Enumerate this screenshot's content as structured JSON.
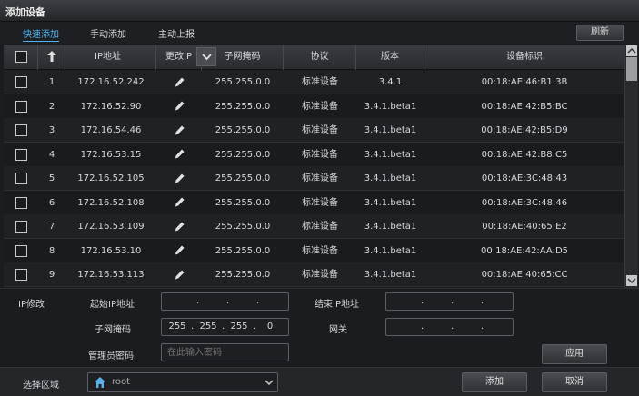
{
  "window": {
    "title": "添加设备"
  },
  "tabs": [
    {
      "label": "快速添加",
      "active": true
    },
    {
      "label": "手动添加",
      "active": false
    },
    {
      "label": "主动上报",
      "active": false
    }
  ],
  "toolbar": {
    "refresh_label": "刷新"
  },
  "table": {
    "columns": [
      "IP地址",
      "更改IP",
      "子网掩码",
      "协议",
      "版本",
      "设备标识"
    ],
    "rows": [
      {
        "index": "1",
        "ip": "172.16.52.242",
        "mask": "255.255.0.0",
        "protocol": "标准设备",
        "version": "3.4.1",
        "id": "00:18:AE:46:B1:3B"
      },
      {
        "index": "2",
        "ip": "172.16.52.90",
        "mask": "255.255.0.0",
        "protocol": "标准设备",
        "version": "3.4.1.beta1",
        "id": "00:18:AE:42:B5:BC"
      },
      {
        "index": "3",
        "ip": "172.16.54.46",
        "mask": "255.255.0.0",
        "protocol": "标准设备",
        "version": "3.4.1.beta1",
        "id": "00:18:AE:42:B5:D9"
      },
      {
        "index": "4",
        "ip": "172.16.53.15",
        "mask": "255.255.0.0",
        "protocol": "标准设备",
        "version": "3.4.1.beta1",
        "id": "00:18:AE:42:B8:C5"
      },
      {
        "index": "5",
        "ip": "172.16.52.105",
        "mask": "255.255.0.0",
        "protocol": "标准设备",
        "version": "3.4.1.beta1",
        "id": "00:18:AE:3C:48:43"
      },
      {
        "index": "6",
        "ip": "172.16.52.108",
        "mask": "255.255.0.0",
        "protocol": "标准设备",
        "version": "3.4.1.beta1",
        "id": "00:18:AE:3C:48:46"
      },
      {
        "index": "7",
        "ip": "172.16.53.109",
        "mask": "255.255.0.0",
        "protocol": "标准设备",
        "version": "3.4.1.beta1",
        "id": "00:18:AE:40:65:E2"
      },
      {
        "index": "8",
        "ip": "172.16.53.10",
        "mask": "255.255.0.0",
        "protocol": "标准设备",
        "version": "3.4.1.beta1",
        "id": "00:18:AE:42:AA:D5"
      },
      {
        "index": "9",
        "ip": "172.16.53.113",
        "mask": "255.255.0.0",
        "protocol": "标准设备",
        "version": "3.4.1.beta1",
        "id": "00:18:AE:40:65:CC"
      }
    ]
  },
  "ip_edit": {
    "section_label": "IP修改",
    "start_ip_label": "起始IP地址",
    "end_ip_label": "结束IP地址",
    "mask_label": "子网掩码",
    "gateway_label": "网关",
    "password_label": "管理员密码",
    "password_placeholder": "在此输入密码",
    "mask_value": [
      "255",
      "255",
      "255",
      "0"
    ],
    "apply_label": "应用"
  },
  "footer": {
    "area_label": "选择区域",
    "area_value": "root",
    "add_label": "添加",
    "cancel_label": "取消"
  },
  "colors": {
    "accent": "#4fb4f0",
    "background": "#1b1c1f"
  },
  "icons": [
    "sort-up-icon",
    "chevron-down-icon",
    "pencil-icon",
    "home-icon",
    "scroll-up-icon",
    "scroll-down-icon"
  ]
}
